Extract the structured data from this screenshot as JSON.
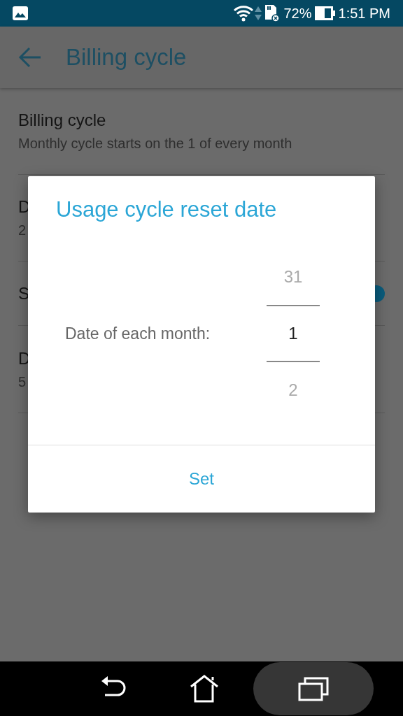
{
  "status_bar": {
    "battery_percent": "72%",
    "time": "1:51 PM"
  },
  "app_bar": {
    "title": "Billing cycle"
  },
  "settings": [
    {
      "kind": "text",
      "title": "Billing cycle",
      "subtitle": "Monthly cycle starts on the 1 of every month"
    },
    {
      "kind": "text",
      "title": "D",
      "subtitle": "2"
    },
    {
      "kind": "switch",
      "title": "S",
      "on": true
    },
    {
      "kind": "text",
      "title": "D",
      "subtitle": "5"
    }
  ],
  "dialog": {
    "title": "Usage cycle reset date",
    "label": "Date of each month:",
    "picker": [
      {
        "value": "31",
        "selected": false
      },
      {
        "value": "1",
        "selected": true
      },
      {
        "value": "2",
        "selected": false
      }
    ],
    "button": "Set"
  }
}
